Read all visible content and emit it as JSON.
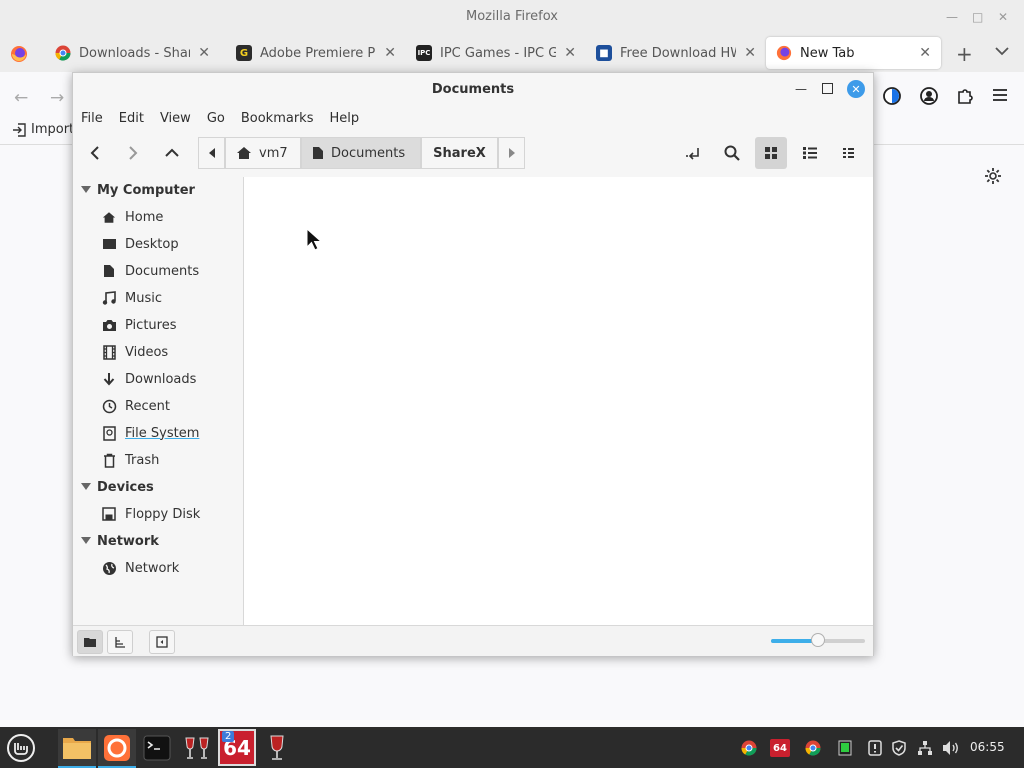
{
  "firefox": {
    "window_title": "Mozilla Firefox",
    "tabs": [
      {
        "label": "Downloads - ShareX",
        "icon": "chrome-icon"
      },
      {
        "label": "Adobe Premiere Pro",
        "icon": "g-site-icon"
      },
      {
        "label": "IPC Games - IPC Gam",
        "icon": "ipc-icon"
      },
      {
        "label": "Free Download HWi",
        "icon": "hw-icon"
      },
      {
        "label": "New Tab",
        "icon": "firefox-icon"
      }
    ],
    "bookmark_import": "Import"
  },
  "nemo": {
    "title": "Documents",
    "menu": [
      "File",
      "Edit",
      "View",
      "Go",
      "Bookmarks",
      "Help"
    ],
    "breadcrumbs": [
      "vm7",
      "Documents",
      "ShareX"
    ],
    "sidebar": {
      "my_computer": "My Computer",
      "computer_items": [
        "Home",
        "Desktop",
        "Documents",
        "Music",
        "Pictures",
        "Videos",
        "Downloads",
        "Recent",
        "File System",
        "Trash"
      ],
      "devices": "Devices",
      "device_items": [
        "Floppy Disk"
      ],
      "network": "Network",
      "network_items": [
        "Network"
      ]
    },
    "zoom_level": 0.5
  },
  "taskbar": {
    "clock": "06:55",
    "badge_count": "2",
    "app_label_64": "64",
    "tray_label_64": "64"
  },
  "colors": {
    "accent": "#3daee9",
    "close_button": "#3d9be9",
    "taskbar": "#2b2b2b",
    "firefox_orange": "#ff7139"
  }
}
